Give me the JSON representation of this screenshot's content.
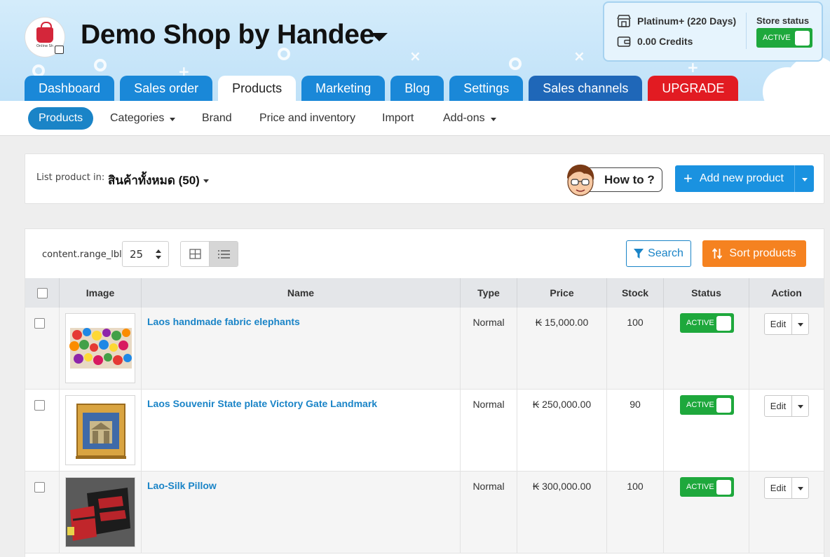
{
  "shop": {
    "title": "Demo Shop by Handee",
    "logo_text": "Online Sh"
  },
  "plan": {
    "package": "Platinum+ (220 Days)",
    "credits": "0.00 Credits"
  },
  "store_status": {
    "label": "Store status",
    "value": "ACTIVE"
  },
  "main_nav": [
    {
      "label": "Dashboard"
    },
    {
      "label": "Sales order"
    },
    {
      "label": "Products"
    },
    {
      "label": "Marketing"
    },
    {
      "label": "Blog"
    },
    {
      "label": "Settings"
    },
    {
      "label": "Sales channels"
    },
    {
      "label": "UPGRADE"
    }
  ],
  "sub_nav": [
    {
      "label": "Products"
    },
    {
      "label": "Categories"
    },
    {
      "label": "Brand"
    },
    {
      "label": "Price and inventory"
    },
    {
      "label": "Import"
    },
    {
      "label": "Add-ons"
    }
  ],
  "list": {
    "label": "List product in:",
    "value": "สินค้าทั้งหมด (50)"
  },
  "how_to": "How to ?",
  "add_new": "Add new product",
  "table_controls": {
    "range_label": "content.range_lbl",
    "per_page": "25",
    "search": "Search",
    "sort": "Sort products"
  },
  "columns": {
    "image": "Image",
    "name": "Name",
    "type": "Type",
    "price": "Price",
    "stock": "Stock",
    "status": "Status",
    "action": "Action"
  },
  "products": [
    {
      "name": "Laos handmade fabric elephants",
      "type": "Normal",
      "price": "₭ 15,000.00",
      "stock": "100",
      "status": "ACTIVE",
      "edit": "Edit"
    },
    {
      "name": "Laos Souvenir State plate Victory Gate Landmark",
      "type": "Normal",
      "price": "₭ 250,000.00",
      "stock": "90",
      "status": "ACTIVE",
      "edit": "Edit"
    },
    {
      "name": "Lao-Silk Pillow",
      "type": "Normal",
      "price": "₭ 300,000.00",
      "stock": "100",
      "status": "ACTIVE",
      "edit": "Edit"
    }
  ],
  "colors": {
    "primary": "#1a88d8",
    "dark_nav": "#1f67b8",
    "upgrade": "#e21b22",
    "active_green": "#1ea83c",
    "sort_orange": "#f58220",
    "link": "#1a84c7"
  },
  "icons": [
    "store-icon",
    "wallet-icon",
    "caret-down-icon",
    "plus-icon",
    "filter-icon",
    "sort-icon",
    "grid-view-icon",
    "list-view-icon"
  ]
}
